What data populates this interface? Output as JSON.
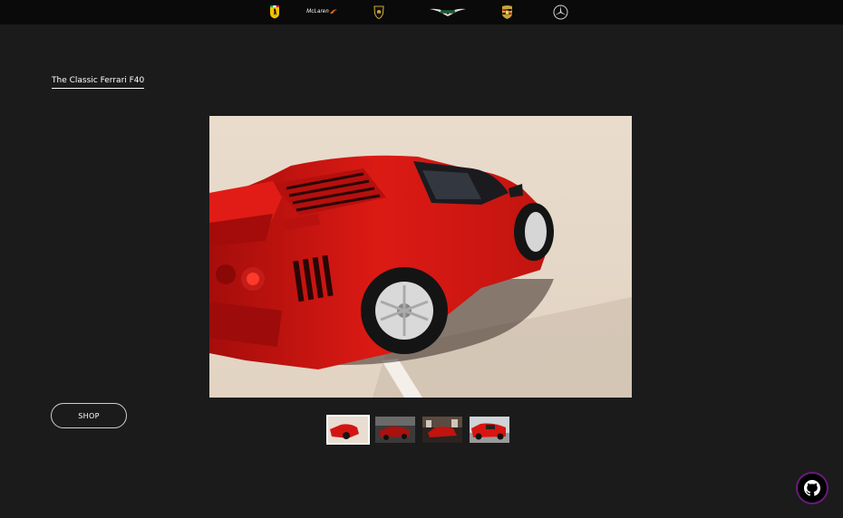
{
  "nav": {
    "brands": [
      {
        "name": "ferrari-logo"
      },
      {
        "name": "mclaren-logo",
        "text": "McLaren"
      },
      {
        "name": "lamborghini-logo"
      },
      {
        "name": "aston-martin-logo"
      },
      {
        "name": "porsche-logo"
      },
      {
        "name": "mercedes-logo"
      }
    ]
  },
  "main": {
    "title": "The Classic Ferrari F40",
    "shop_label": "SHOP",
    "hero_image": "red-ferrari-f40-rear-three-quarter",
    "thumbnails": [
      {
        "label": "thumbnail-1",
        "active": true
      },
      {
        "label": "thumbnail-2",
        "active": false
      },
      {
        "label": "thumbnail-3",
        "active": false
      },
      {
        "label": "thumbnail-4",
        "active": false
      }
    ]
  },
  "footer": {
    "github_icon": "github-icon"
  },
  "colors": {
    "background": "#1b1b1b",
    "topbar": "#0a0a0a",
    "car_red": "#d31512",
    "accent_ring": "#6a1b7a"
  }
}
